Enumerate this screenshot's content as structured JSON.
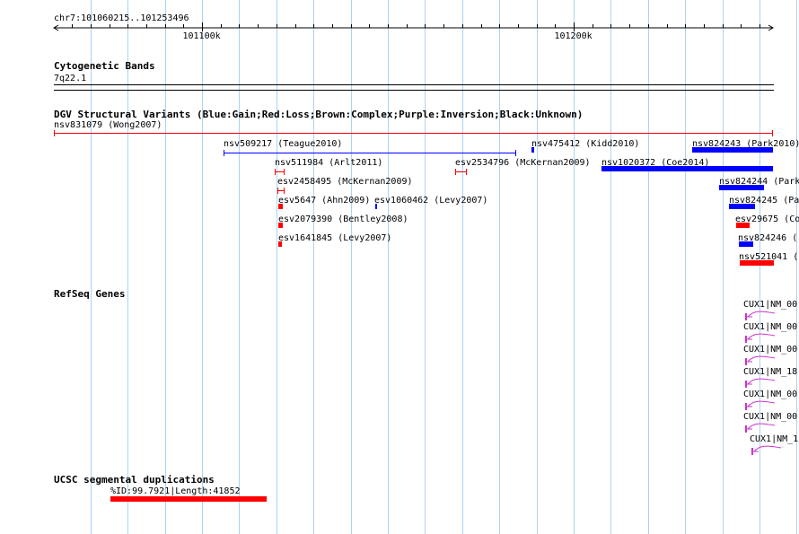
{
  "ruler": {
    "label": "chr7:101060215..101253496",
    "ticks": [
      {
        "pos": 101100000,
        "label": "101100k"
      },
      {
        "pos": 101200000,
        "label": "101200k"
      }
    ]
  },
  "tracks": {
    "cytoband": {
      "title": "Cytogenetic Bands",
      "band": "7q22.1"
    },
    "dgv": {
      "title": "DGV Structural Variants (Blue:Gain;Red:Loss;Brown:Complex;Purple:Inversion;Black:Unknown)",
      "features": [
        {
          "label": "nsv831079 (Wong2007)",
          "color": "#ff0000",
          "style": "line"
        },
        {
          "label": "nsv509217 (Teague2010)",
          "color": "#0000ff",
          "style": "line"
        },
        {
          "label": "nsv475412 (Kidd2010)",
          "color": "#0000ff",
          "style": "box"
        },
        {
          "label": "nsv824243 (Park2010)",
          "color": "#0000ff",
          "style": "box"
        },
        {
          "label": "nsv511984 (Arlt2011)",
          "color": "#ff0000",
          "style": "line"
        },
        {
          "label": "esv2534796 (McKernan2009)",
          "color": "#ff0000",
          "style": "line"
        },
        {
          "label": "nsv1020372 (Coe2014)",
          "color": "#0000ff",
          "style": "box"
        },
        {
          "label": "esv2458495 (McKernan2009)",
          "color": "#ff0000",
          "style": "line"
        },
        {
          "label": "nsv824244 (Park",
          "color": "#0000ff",
          "style": "box"
        },
        {
          "label": "esv5647 (Ahn2009)",
          "color": "#ff0000",
          "style": "box"
        },
        {
          "label": "esv1060462 (Levy2007)",
          "color": "#0000ff",
          "style": "box"
        },
        {
          "label": "nsv824245 (Pa",
          "color": "#0000ff",
          "style": "box"
        },
        {
          "label": "esv2079390 (Bentley2008)",
          "color": "#ff0000",
          "style": "box"
        },
        {
          "label": "esv29675 (Co",
          "color": "#ff0000",
          "style": "box"
        },
        {
          "label": "esv1641845 (Levy2007)",
          "color": "#ff0000",
          "style": "box"
        },
        {
          "label": "nsv824246 (",
          "color": "#0000ff",
          "style": "box"
        },
        {
          "label": "nsv521041 (",
          "color": "#ff0000",
          "style": "box"
        }
      ]
    },
    "refseq": {
      "title": "RefSeq Genes",
      "color": "#cc33cc",
      "features": [
        {
          "label": "CUX1|NM_00"
        },
        {
          "label": "CUX1|NM_00"
        },
        {
          "label": "CUX1|NM_00"
        },
        {
          "label": "CUX1|NM_18"
        },
        {
          "label": "CUX1|NM_00"
        },
        {
          "label": "CUX1|NM_00"
        },
        {
          "label": "CUX1|NM_1"
        }
      ]
    },
    "segdup": {
      "title": "UCSC segmental duplications",
      "color": "#ff0000",
      "features": [
        {
          "label": "%ID:99.7921|Length:41852"
        }
      ]
    }
  }
}
